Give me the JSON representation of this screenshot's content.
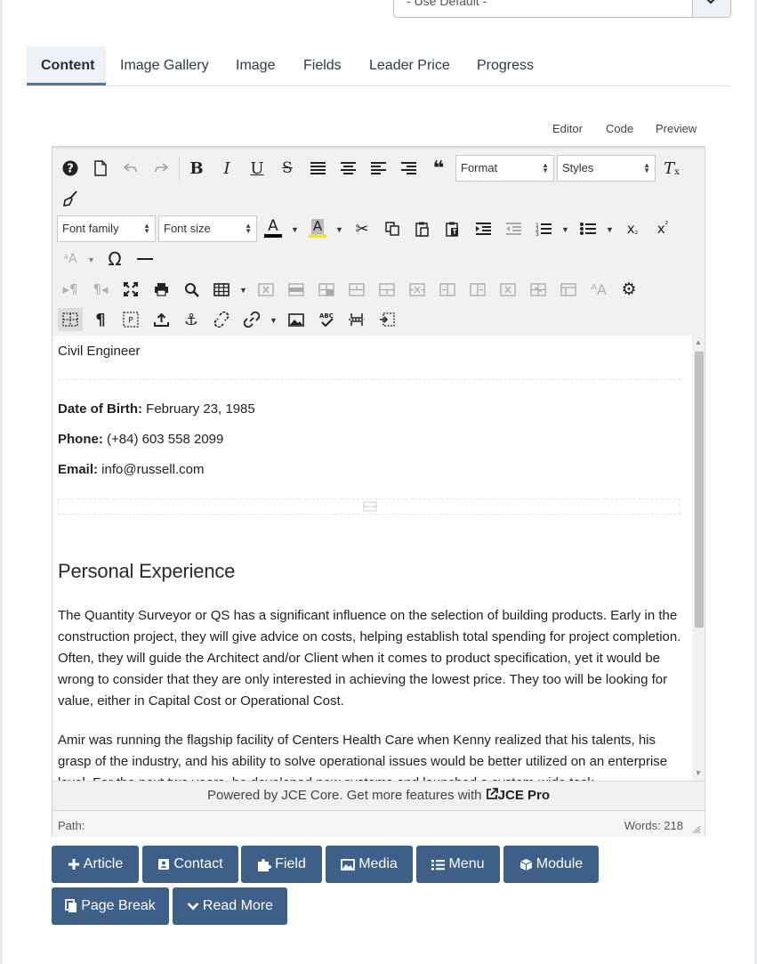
{
  "top_select": {
    "value": "- Use Default -",
    "chevron_icon": "chevron-down-icon"
  },
  "tabs": [
    {
      "label": "Content",
      "active": true
    },
    {
      "label": "Image Gallery"
    },
    {
      "label": "Image"
    },
    {
      "label": "Fields"
    },
    {
      "label": "Leader Price"
    },
    {
      "label": "Progress"
    }
  ],
  "editor_modes": {
    "editor": "Editor",
    "code": "Code",
    "preview": "Preview"
  },
  "toolbar": {
    "format_select": "Format",
    "styles_select": "Styles",
    "font_family_select": "Font family",
    "font_size_select": "Font size",
    "text_color": "#000000",
    "highlight_color": "#f1e03a"
  },
  "content": {
    "subtitle": "Civil Engineer",
    "dob_label": "Date of Birth:",
    "dob_value": " February 23, 1985",
    "phone_label": "Phone:",
    "phone_value": " (+84) 603 558 2099",
    "email_label": "Email:",
    "email_value": " info@russell.com",
    "heading": "Personal Experience",
    "para1": "The Quantity Surveyor or QS has a significant influence on the selection of building products. Early in the construction project, they will give advice on costs, helping establish total spending for project completion. Often, they will guide the Architect and/or Client when it comes to product specification, yet it would be wrong to consider that they are only interested in achieving the lowest price. They too will be looking for value, either in Capital Cost or Operational Cost.",
    "para2": "Amir was running the flagship facility of Centers Health Care when Kenny realized that his talents, his grasp of the industry, and his ability to solve operational issues would be better utilized on an enterprise level. For the next two years, he developed new systems and launched a system-wide task"
  },
  "powered": {
    "text": "Powered by JCE Core. Get more features with ",
    "link": "JCE Pro"
  },
  "status": {
    "path_label": "Path:",
    "words": "Words: 218"
  },
  "buttons": [
    {
      "label": "Article",
      "icon": "plus-icon"
    },
    {
      "label": "Contact",
      "icon": "contact-card-icon"
    },
    {
      "label": "Field",
      "icon": "puzzle-icon"
    },
    {
      "label": "Media",
      "icon": "image-icon"
    },
    {
      "label": "Menu",
      "icon": "list-icon"
    },
    {
      "label": "Module",
      "icon": "cube-icon"
    },
    {
      "label": "Page Break",
      "icon": "copy-icon"
    },
    {
      "label": "Read More",
      "icon": "chevron-down-icon"
    }
  ]
}
